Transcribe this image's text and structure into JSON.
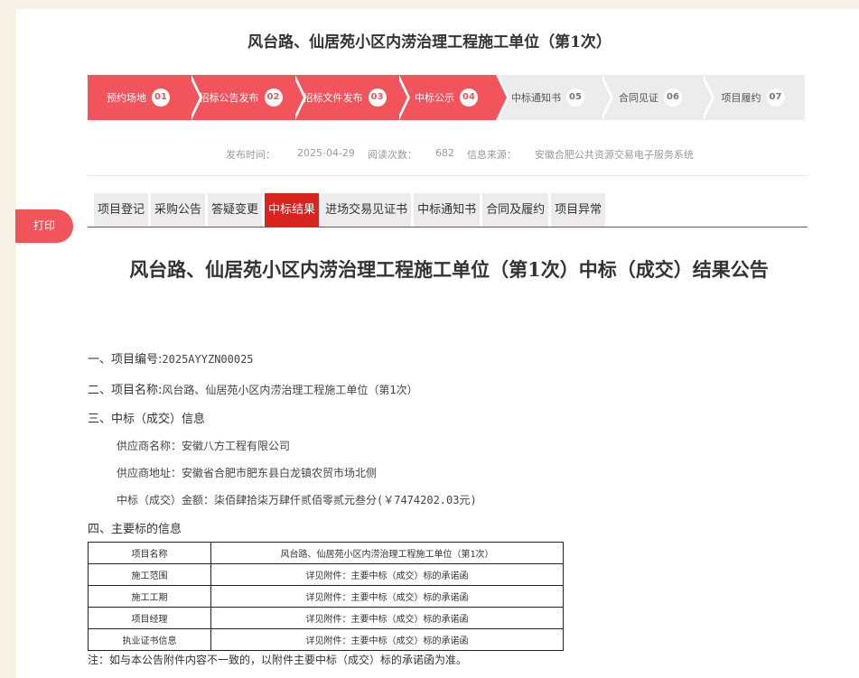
{
  "header": {
    "title": "风台路、仙居苑小区内涝治理工程施工单位（第1次）"
  },
  "steps": [
    {
      "label": "预约场地",
      "num": "01",
      "state": "done"
    },
    {
      "label": "招标公告发布",
      "num": "02",
      "state": "done"
    },
    {
      "label": "招标文件发布",
      "num": "03",
      "state": "done"
    },
    {
      "label": "中标公示",
      "num": "04",
      "state": "done"
    },
    {
      "label": "中标通知书",
      "num": "05",
      "state": "todo"
    },
    {
      "label": "合同见证",
      "num": "06",
      "state": "todo"
    },
    {
      "label": "项目履约",
      "num": "07",
      "state": "todo"
    }
  ],
  "meta": {
    "publish_label": "发布时间：",
    "publish_value": "2025-04-29",
    "views_label": "阅读次数：",
    "views_value": "682",
    "source_label": "信息来源：",
    "source_value": "安徽合肥公共资源交易电子服务系统"
  },
  "tabs": [
    {
      "label": "项目登记"
    },
    {
      "label": "采购公告"
    },
    {
      "label": "答疑变更"
    },
    {
      "label": "中标结果",
      "active": true
    },
    {
      "label": "进场交易见证书"
    },
    {
      "label": "中标通知书"
    },
    {
      "label": "合同及履约"
    },
    {
      "label": "项目异常"
    }
  ],
  "print_label": "打印",
  "announcement": {
    "title": "风台路、仙居苑小区内涝治理工程施工单位（第1次）中标（成交）结果公告",
    "item1_label": "一、项目编号:",
    "item1_value": "2025AYYZN00025",
    "item2_label": "二、项目名称:",
    "item2_value": "风台路、仙居苑小区内涝治理工程施工单位（第1次）",
    "item3_label": "三、中标（成交）信息",
    "supplier_name": "供应商名称：安徽八方工程有限公司",
    "supplier_address": "供应商地址：安徽省合肥市肥东县白龙镇农贸市场北侧",
    "amount": "中标（成交）金额：柒佰肆拾柒万肆仟贰佰零贰元叁分(￥7474202.03元)",
    "item4_label": "四、主要标的信息",
    "table": [
      {
        "k": "项目名称",
        "v": "风台路、仙居苑小区内涝治理工程施工单位（第1次）"
      },
      {
        "k": "施工范围",
        "v": "详见附件：主要中标（成交）标的承诺函"
      },
      {
        "k": "施工工期",
        "v": "详见附件：主要中标（成交）标的承诺函"
      },
      {
        "k": "项目经理",
        "v": "详见附件：主要中标（成交）标的承诺函"
      },
      {
        "k": "执业证书信息",
        "v": "详见附件：主要中标（成交）标的承诺函"
      }
    ],
    "note": "注：如与本公告附件内容不一致的，以附件主要中标（成交）标的承诺函为准。"
  }
}
